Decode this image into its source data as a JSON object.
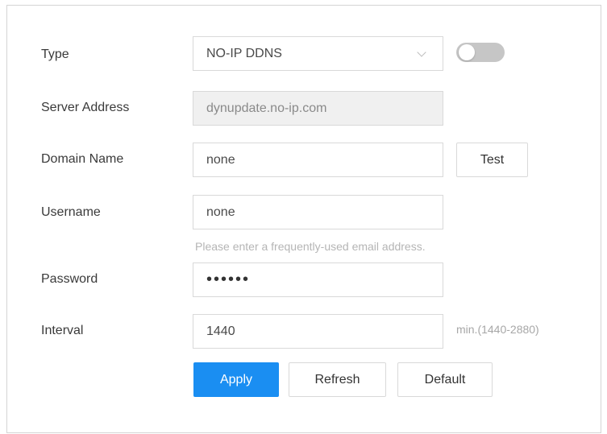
{
  "form": {
    "type": {
      "label": "Type",
      "value": "NO-IP DDNS",
      "enabled": false
    },
    "server_address": {
      "label": "Server Address",
      "value": "dynupdate.no-ip.com"
    },
    "domain_name": {
      "label": "Domain Name",
      "value": "none",
      "test_label": "Test"
    },
    "username": {
      "label": "Username",
      "value": "none",
      "hint": "Please enter a frequently-used email address."
    },
    "password": {
      "label": "Password",
      "value": "••••••"
    },
    "interval": {
      "label": "Interval",
      "value": "1440",
      "unit": "min.(1440-2880)"
    }
  },
  "buttons": {
    "apply": "Apply",
    "refresh": "Refresh",
    "default": "Default"
  },
  "colors": {
    "primary": "#1a8ef2",
    "toggle_off": "#c6c6c6",
    "readonly_bg": "#f0f0f0"
  }
}
